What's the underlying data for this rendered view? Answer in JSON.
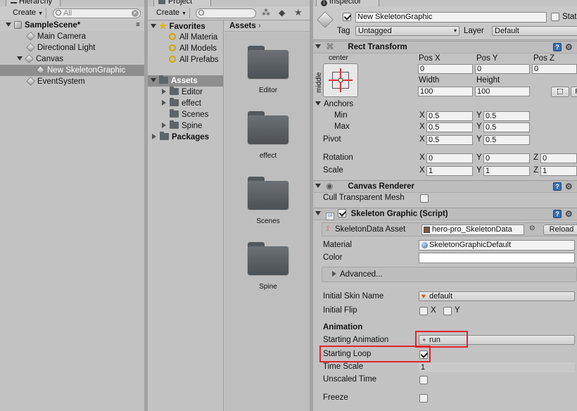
{
  "hierarchy": {
    "tab_label": "Hierarchy",
    "create_label": "Create",
    "search_placeholder": "All",
    "scene_name": "SampleScene*",
    "items": [
      {
        "label": "Main Camera"
      },
      {
        "label": "Directional Light"
      },
      {
        "label": "Canvas"
      },
      {
        "label": "New SkeletonGraphic"
      },
      {
        "label": "EventSystem"
      }
    ]
  },
  "project": {
    "tab_label": "Project",
    "create_label": "Create",
    "favorites_label": "Favorites",
    "favorites": [
      {
        "label": "All Materia"
      },
      {
        "label": "All Models"
      },
      {
        "label": "All Prefabs"
      }
    ],
    "assets_label": "Assets",
    "asset_folders": [
      {
        "label": "Editor"
      },
      {
        "label": "effect"
      },
      {
        "label": "Scenes"
      },
      {
        "label": "Spine"
      }
    ],
    "packages_label": "Packages",
    "breadcrumb": "Assets",
    "grid": [
      {
        "label": "Editor"
      },
      {
        "label": "effect"
      },
      {
        "label": "Scenes"
      },
      {
        "label": "Spine"
      }
    ]
  },
  "inspector": {
    "tab_label": "Inspector",
    "object_name": "New SkeletonGraphic",
    "static_label": "Static",
    "tag_label": "Tag",
    "tag_value": "Untagged",
    "layer_label": "Layer",
    "layer_value": "Default",
    "rect_transform": {
      "title": "Rect Transform",
      "anchor_h": "center",
      "anchor_v": "middle",
      "pos_x_label": "Pos X",
      "pos_y_label": "Pos Y",
      "pos_z_label": "Pos Z",
      "pos_x": "0",
      "pos_y": "0",
      "pos_z": "0",
      "width_label": "Width",
      "height_label": "Height",
      "width": "100",
      "height": "100",
      "anchors_label": "Anchors",
      "min_label": "Min",
      "max_label": "Max",
      "min_x": "0.5",
      "min_y": "0.5",
      "max_x": "0.5",
      "max_y": "0.5",
      "pivot_label": "Pivot",
      "pivot_x": "0.5",
      "pivot_y": "0.5",
      "rotation_label": "Rotation",
      "rot_x": "0",
      "rot_y": "0",
      "rot_z": "0",
      "scale_label": "Scale",
      "scale_x": "1",
      "scale_y": "1",
      "scale_z": "1",
      "x": "X",
      "y": "Y",
      "z": "Z"
    },
    "canvas_renderer": {
      "title": "Canvas Renderer",
      "cull_label": "Cull Transparent Mesh"
    },
    "skeleton_graphic": {
      "title": "Skeleton Graphic (Script)",
      "skeleton_data_label": "SkeletonData Asset",
      "skeleton_data_value": "hero-pro_SkeletonData",
      "reload_label": "Reload",
      "material_label": "Material",
      "material_value": "SkeletonGraphicDefault",
      "color_label": "Color",
      "advanced_label": "Advanced...",
      "initial_skin_label": "Initial Skin Name",
      "initial_skin_value": "default",
      "initial_flip_label": "Initial Flip",
      "flip_x": "X",
      "flip_y": "Y",
      "animation_header": "Animation",
      "starting_animation_label": "Starting Animation",
      "starting_animation_value": "run",
      "starting_loop_label": "Starting Loop",
      "time_scale_label": "Time Scale",
      "time_scale_value": "1",
      "unscaled_time_label": "Unscaled Time",
      "freeze_label": "Freeze"
    }
  }
}
